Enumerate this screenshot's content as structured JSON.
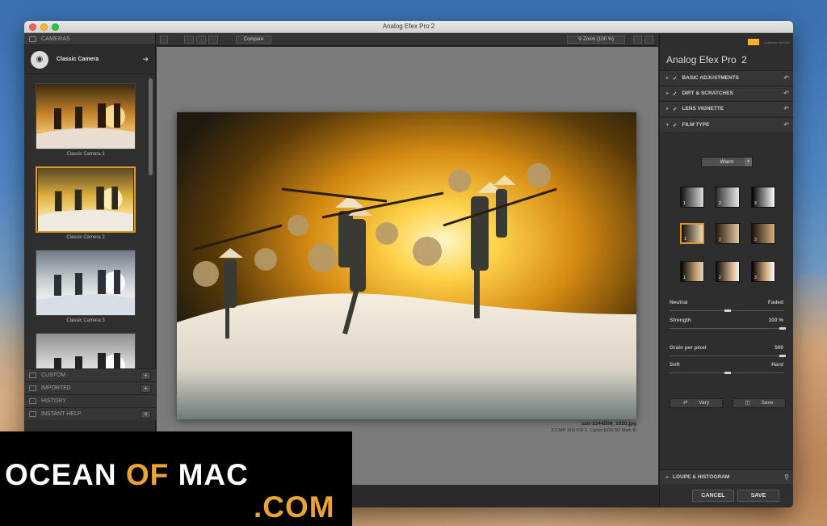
{
  "window": {
    "title": "Analog Efex Pro 2"
  },
  "left_panel": {
    "section_title": "CAMERAS",
    "camera_name": "Classic Camera",
    "presets": [
      {
        "label": "Classic Camera 1"
      },
      {
        "label": "Classic Camera 2",
        "selected": true
      },
      {
        "label": "Classic Camera 3"
      },
      {
        "label": ""
      }
    ],
    "lower_sections": [
      {
        "label": "CUSTOM",
        "action": "+"
      },
      {
        "label": "IMPORTED",
        "action": "+"
      },
      {
        "label": "HISTORY"
      },
      {
        "label": "INSTANT HELP",
        "action": "×"
      }
    ]
  },
  "toolbar": {
    "compare_label": "Compare",
    "zoom_label": "Zoom (100 %)"
  },
  "image": {
    "filename": "salt-3344508_1920.jpg",
    "info": "2.5 MP, ISO 500 0, Canon EOS 5D Mark III"
  },
  "right_panel": {
    "brand": "Analog Efex Pro",
    "brand_version": "2",
    "collection": "Collection by DxO",
    "sections": [
      {
        "label": "BASIC ADJUSTMENTS"
      },
      {
        "label": "DIRT & SCRATCHES"
      },
      {
        "label": "LENS VIGNETTE"
      },
      {
        "label": "FILM TYPE"
      }
    ],
    "film_dropdown": "Warm",
    "sliders": {
      "neutral": "Neutral",
      "faded": "Faded",
      "strength": "Strength",
      "strength_value": "100 %",
      "grain": "Grain per pixel",
      "grain_value": "500",
      "soft": "Soft",
      "hard": "Hard"
    },
    "vary_label": "Vary",
    "save_preset_label": "Save",
    "loupe_label": "LOUPE & HISTOGRAM"
  },
  "footer": {
    "cancel_label": "CANCEL",
    "save_label": "SAVE"
  },
  "watermark": {
    "line1_a": "OCEAN",
    "line1_b": "OF",
    "line1_c": "MAC",
    "line2": ".COM"
  },
  "colors": {
    "accent": "#d99a2b",
    "watermark_orange": "#e9a431"
  }
}
